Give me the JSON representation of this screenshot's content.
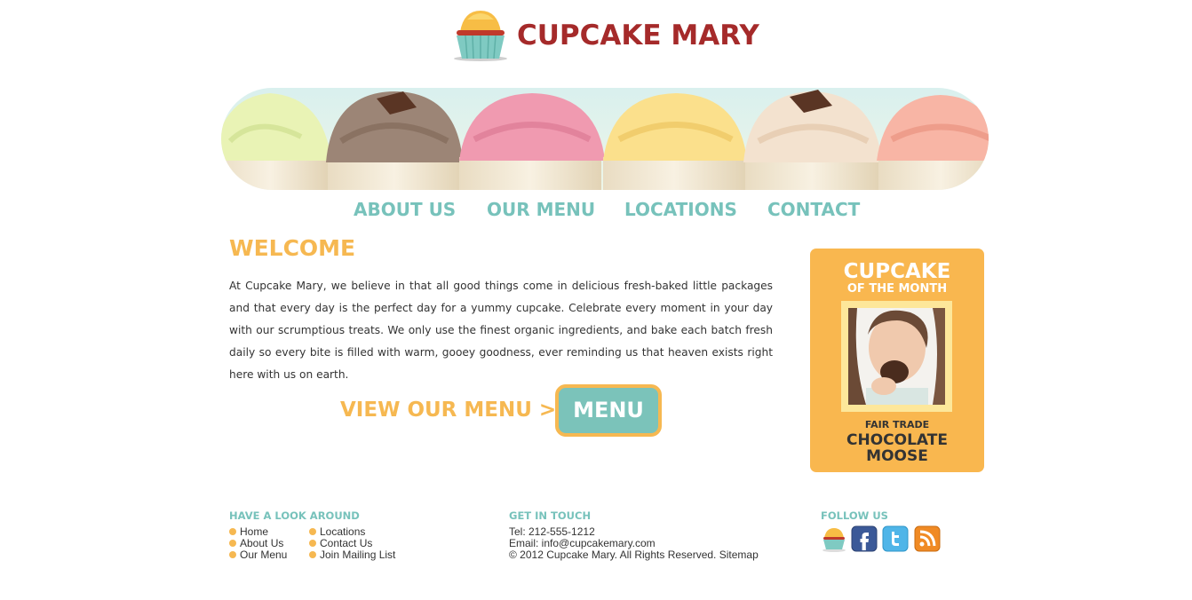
{
  "brand": {
    "name": "CUPCAKE MARY"
  },
  "nav": {
    "items": [
      "ABOUT US",
      "OUR MENU",
      "LOCATIONS",
      "CONTACT"
    ]
  },
  "welcome": {
    "title": "WELCOME",
    "body": "At Cupcake Mary, we believe in that all good things come in delicious fresh-baked little packages and that every day is the perfect day for a yummy cupcake. Celebrate every moment in your day with our scrumptious treats. We only use the finest organic ingredients, and bake each batch fresh daily so every bite is filled with warm, gooey goodness, ever reminding us that heaven exists right here with us on earth.",
    "cta_text": "VIEW OUR MENU >",
    "cta_button": "MENU"
  },
  "sidebar": {
    "title": "CUPCAKE",
    "subtitle": "OF THE MONTH",
    "label": "FAIR TRADE",
    "name_line1": "CHOCOLATE",
    "name_line2": "MOOSE"
  },
  "footer": {
    "look_around": {
      "heading": "HAVE A LOOK AROUND",
      "col1": [
        "Home",
        "About Us",
        "Our Menu"
      ],
      "col2": [
        "Locations",
        "Contact Us",
        "Join Mailing List"
      ]
    },
    "get_in_touch": {
      "heading": "GET IN TOUCH",
      "tel": "Tel: 212-555-1212",
      "email": "Email: info@cupcakemary.com",
      "copyright": "© 2012 Cupcake Mary. All Rights Reserved. Sitemap"
    },
    "follow_us": {
      "heading": "FOLLOW US",
      "icons": [
        "cupcake-icon",
        "facebook-icon",
        "twitter-icon",
        "rss-icon"
      ]
    }
  },
  "colors": {
    "brand_red": "#a52a2a",
    "teal": "#77c2bb",
    "orange": "#f6b851",
    "sidebar_bg": "#f9b74f"
  }
}
